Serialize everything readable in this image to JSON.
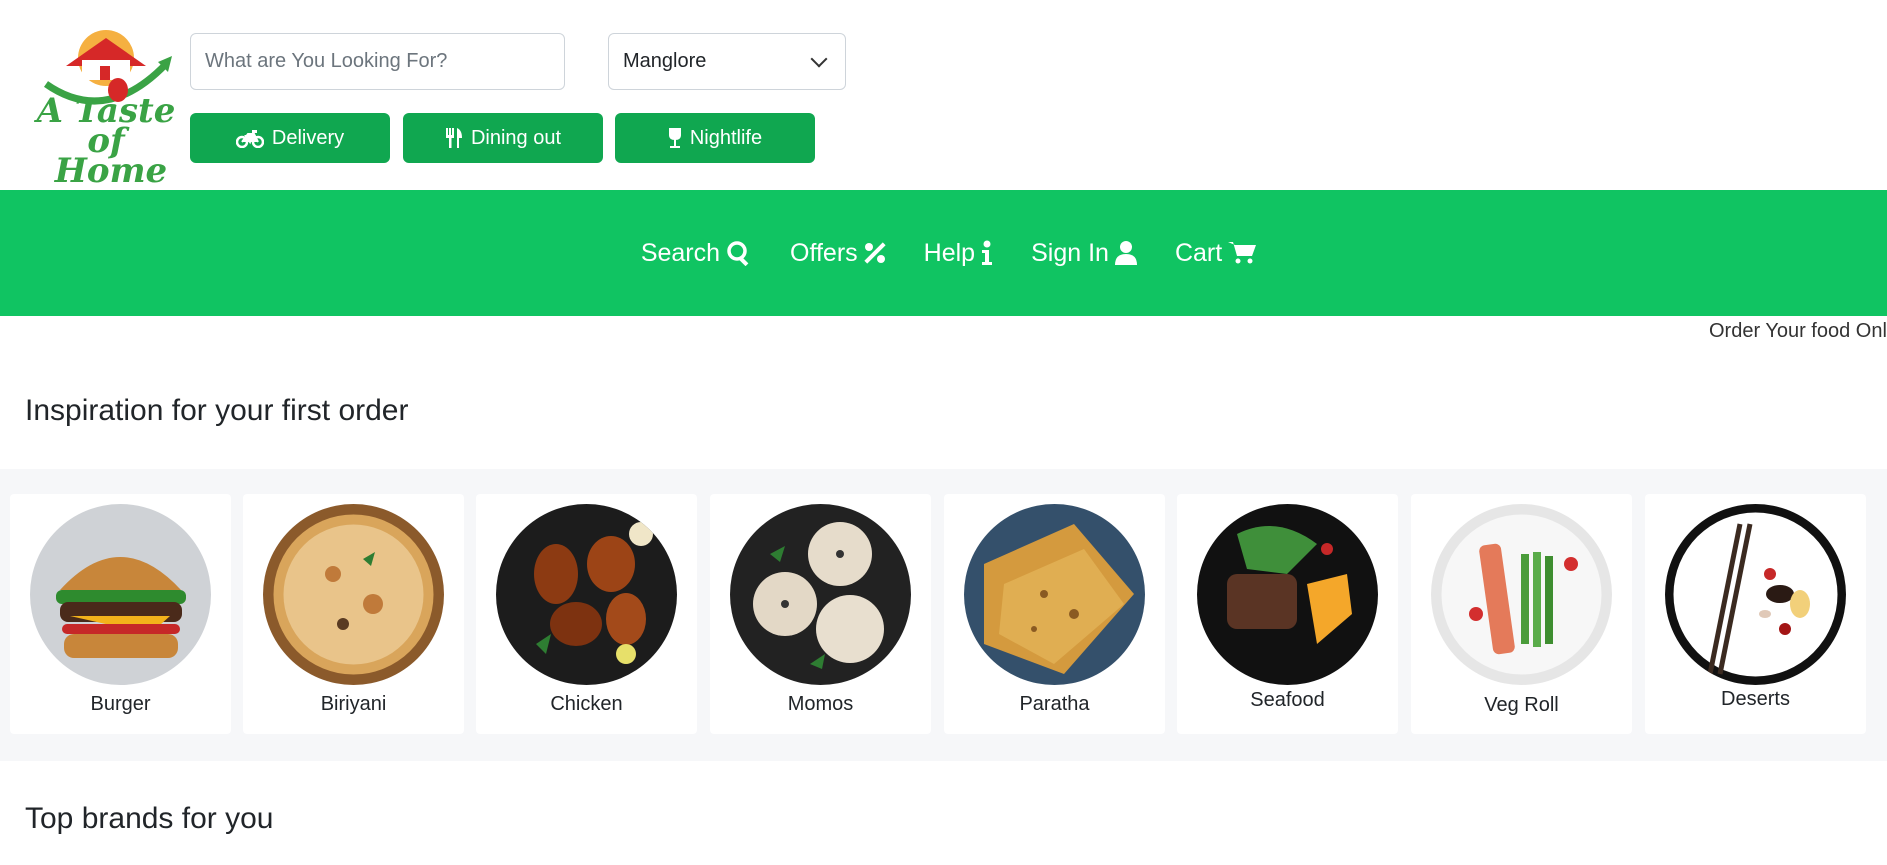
{
  "brand": {
    "logo_line1": "A Taste of",
    "logo_line2": "Home"
  },
  "search": {
    "placeholder": "What are You Looking For?"
  },
  "location": {
    "selected": "Manglore"
  },
  "modes": [
    {
      "label": "Delivery",
      "icon": "motorcycle-icon"
    },
    {
      "label": "Dining out",
      "icon": "utensils-icon"
    },
    {
      "label": "Nightlife",
      "icon": "wine-glass-icon"
    }
  ],
  "nav": [
    {
      "label": "Search",
      "icon": "search-icon"
    },
    {
      "label": "Offers",
      "icon": "percent-icon"
    },
    {
      "label": "Help",
      "icon": "info-icon"
    },
    {
      "label": "Sign In",
      "icon": "user-icon"
    },
    {
      "label": "Cart",
      "icon": "cart-icon"
    }
  ],
  "marquee_text": "Order Your food Onl",
  "sections": {
    "inspiration_title": "Inspiration for your first order",
    "brands_title": "Top brands for you"
  },
  "categories": [
    {
      "label": "Burger"
    },
    {
      "label": "Biriyani"
    },
    {
      "label": "Chicken"
    },
    {
      "label": "Momos"
    },
    {
      "label": "Paratha"
    },
    {
      "label": "Seafood"
    },
    {
      "label": "Veg Roll"
    },
    {
      "label": "Deserts"
    }
  ],
  "colors": {
    "primary_green": "#10a750",
    "nav_green": "#10c462",
    "band_gray": "#f6f7f9"
  }
}
